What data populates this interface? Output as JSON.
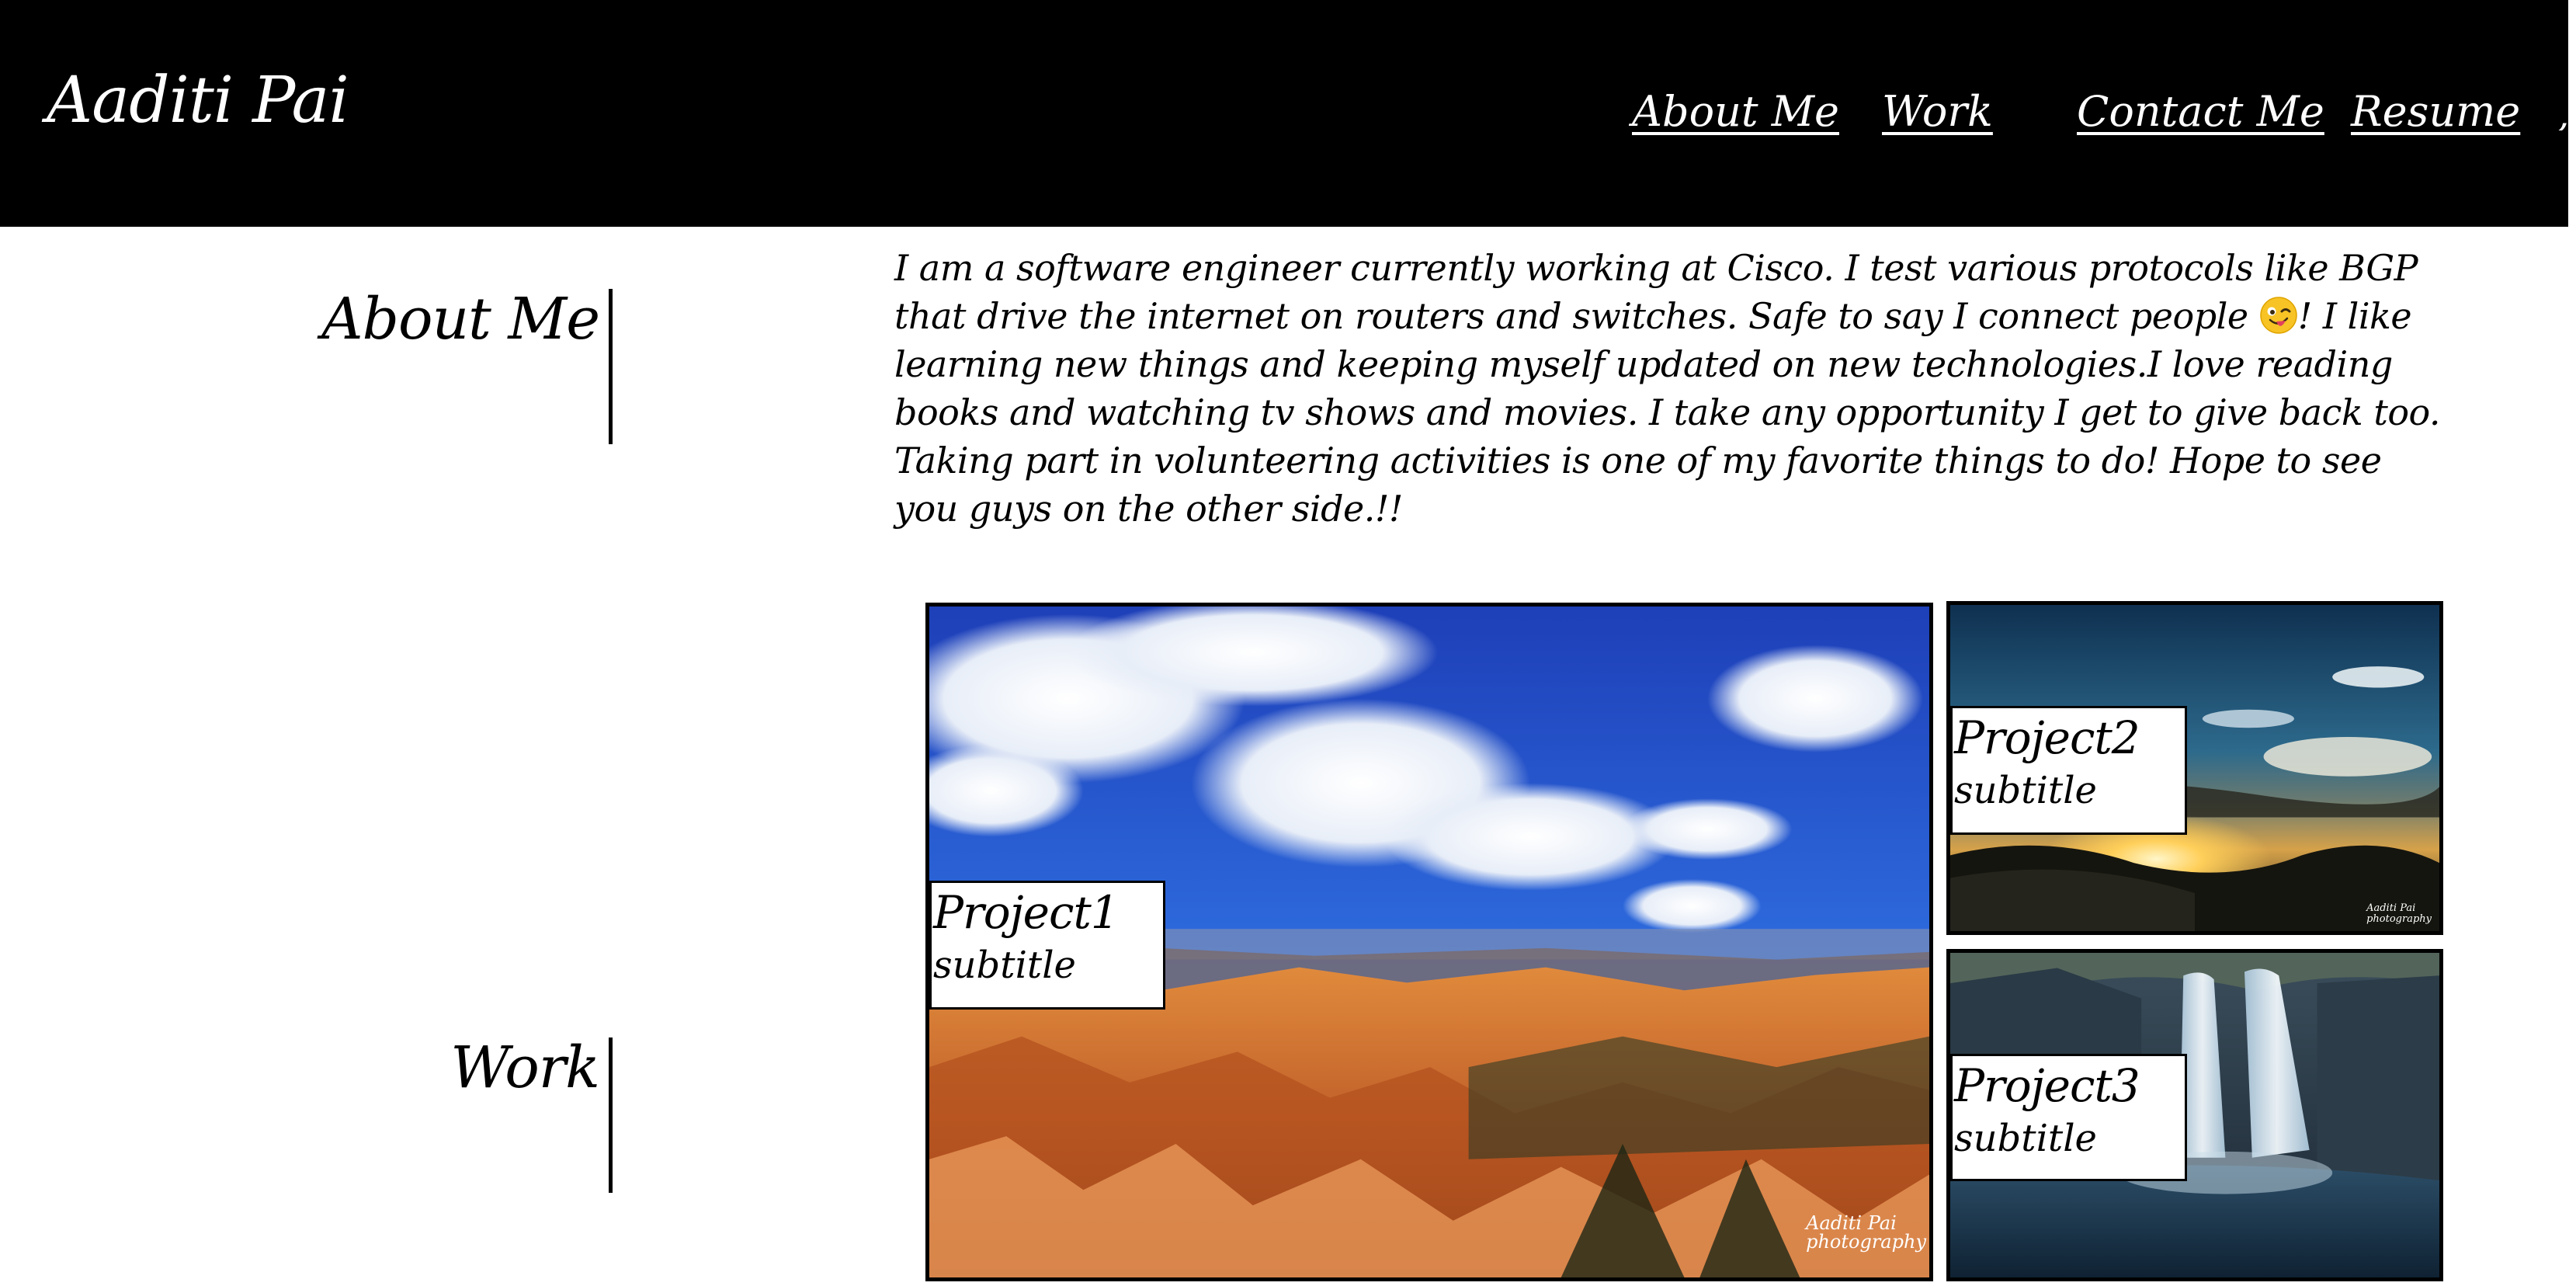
{
  "header": {
    "brand": "Aaditi Pai",
    "nav": [
      "About Me",
      "Work",
      "Contact Me",
      "Resume"
    ],
    "nav_overflow_glyph": ","
  },
  "about": {
    "title": "About Me",
    "text_before_emoji": "I am a software engineer currently working at Cisco. I test various protocols like BGP that drive the internet on routers and switches. Safe to say I connect people ",
    "emoji": "winking-tongue-face-icon",
    "text_after_emoji": "! I like learning new things and keeping myself updated on new technologies.I love reading books and watching tv shows and movies. I take any opportunity I get to give back too. Taking part in volunteering activities is one of my favorite things to do! Hope to see you guys on the other side.!!"
  },
  "work": {
    "title": "Work",
    "projects": [
      {
        "title": "Project1",
        "subtitle": "subtitle",
        "watermark_line1": "Aaditi Pai",
        "watermark_line2": "photography",
        "image": "canyon-landscape-photo"
      },
      {
        "title": "Project2",
        "subtitle": "subtitle",
        "watermark_line1": "Aaditi Pai",
        "watermark_line2": "photography",
        "image": "sunset-over-hills-photo"
      },
      {
        "title": "Project3",
        "subtitle": "subtitle",
        "image": "waterfall-photo"
      }
    ]
  },
  "colors": {
    "header_bg": "#000000",
    "page_bg": "#ffffff",
    "text": "#000000",
    "nav_text": "#ffffff"
  }
}
